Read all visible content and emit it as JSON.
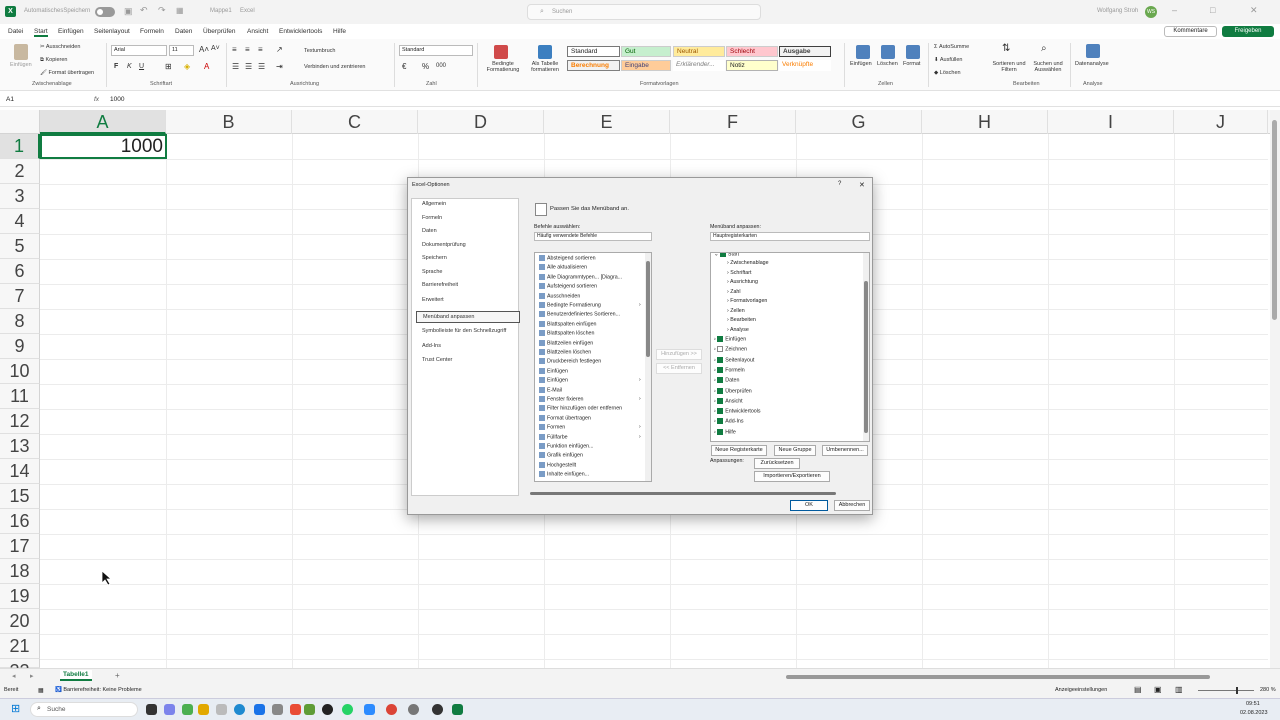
{
  "window": {
    "autosave_label": "AutomatischesSpeichern",
    "file_name": "Mappe1",
    "app_name": "Excel",
    "search_placeholder": "Suchen",
    "user_name": "Wolfgang Stroh",
    "user_initials": "WS"
  },
  "menu": {
    "items": [
      "Datei",
      "Start",
      "Einfügen",
      "Seitenlayout",
      "Formeln",
      "Daten",
      "Überprüfen",
      "Ansicht",
      "Entwicklertools",
      "Hilfe"
    ],
    "active": "Start",
    "comments_label": "Kommentare",
    "share_label": "Freigeben"
  },
  "ribbon": {
    "clipboard": {
      "paste": "Einfügen",
      "cut": "Ausschneiden",
      "copy": "Kopieren",
      "format_painter": "Format übertragen",
      "label": "Zwischenablage"
    },
    "font": {
      "name": "Arial",
      "size": "11",
      "bold": "F",
      "italic": "K",
      "underline": "U",
      "label": "Schriftart"
    },
    "alignment": {
      "wrap": "Textumbruch",
      "merge": "Verbinden und zentrieren",
      "label": "Ausrichtung"
    },
    "number": {
      "format": "Standard",
      "percent": "%",
      "comma": "000",
      "label": "Zahl"
    },
    "styles": {
      "cond_format": "Bedingte Formatierung",
      "as_table": "Als Tabelle formatieren",
      "cells": [
        "Standard",
        "Gut",
        "Neutral",
        "Schlecht",
        "Ausgabe",
        "Berechnung",
        "Eingabe",
        "Erklärender...",
        "Notiz",
        "Verknüpfte"
      ],
      "label": "Formatvorlagen"
    },
    "cells": {
      "insert": "Einfügen",
      "delete": "Löschen",
      "format": "Format",
      "label": "Zellen"
    },
    "editing": {
      "autosum": "AutoSumme",
      "fill": "Ausfüllen",
      "clear": "Löschen",
      "sort": "Sortieren und Filtern",
      "find": "Suchen und Auswählen",
      "label": "Bearbeiten"
    },
    "analysis": {
      "data_analysis": "Datenanalyse",
      "label": "Analyse"
    }
  },
  "formula_bar": {
    "name_box": "A1",
    "fx": "fx",
    "value": "1000"
  },
  "grid": {
    "columns": [
      "A",
      "B",
      "C",
      "D",
      "E",
      "F",
      "G",
      "H",
      "I",
      "J"
    ],
    "rows": [
      "1",
      "2",
      "3",
      "4",
      "5",
      "6",
      "7",
      "8",
      "9",
      "10",
      "11",
      "12",
      "13",
      "14",
      "15",
      "16",
      "17",
      "18",
      "19",
      "20",
      "21",
      "22"
    ],
    "a1_value": "1000"
  },
  "dialog": {
    "title": "Excel-Optionen",
    "help": "?",
    "close": "✕",
    "categories": [
      "Allgemein",
      "Formeln",
      "Daten",
      "Dokumentprüfung",
      "Speichern",
      "Sprache",
      "Barrierefreiheit",
      "Erweitert",
      "Menüband anpassen",
      "Symbolleiste für den Schnellzugriff",
      "Add-Ins",
      "Trust Center"
    ],
    "active_category": "Menüband anpassen",
    "heading": "Passen Sie das Menüband an.",
    "commands_label": "Befehle auswählen:",
    "commands_select": "Häufig verwendete Befehle",
    "ribbon_label": "Menüband anpassen:",
    "ribbon_select": "Hauptregisterkarten",
    "commands": [
      "Absteigend sortieren",
      "Alle aktualisieren",
      "Alle Diagrammtypen... [Diagra...",
      "Aufsteigend sortieren",
      "Ausschneiden",
      "Bedingte Formatierung",
      "Benutzerdefiniertes Sortieren...",
      "Blattspalten einfügen",
      "Blattspalten löschen",
      "Blattzeilen einfügen",
      "Blattzeilen löschen",
      "Druckbereich festlegen",
      "Einfügen",
      "Einfügen",
      "E-Mail",
      "Fenster fixieren",
      "Filter hinzufügen oder entfernen",
      "Format übertragen",
      "Formen",
      "Füllfarbe",
      "Funktion einfügen...",
      "Grafik einfügen",
      "Hochgestellt",
      "Inhalte einfügen..."
    ],
    "add_button": "Hinzufügen >>",
    "remove_button": "<< Entfernen",
    "tree_root": "Start",
    "tree_children": [
      "Zwischenablage",
      "Schriftart",
      "Ausrichtung",
      "Zahl",
      "Formatvorlagen",
      "Zellen",
      "Bearbeiten",
      "Analyse"
    ],
    "tabs": [
      {
        "label": "Einfügen",
        "checked": true
      },
      {
        "label": "Zeichnen",
        "checked": false
      },
      {
        "label": "Seitenlayout",
        "checked": true
      },
      {
        "label": "Formeln",
        "checked": true
      },
      {
        "label": "Daten",
        "checked": true
      },
      {
        "label": "Überprüfen",
        "checked": true
      },
      {
        "label": "Ansicht",
        "checked": true
      },
      {
        "label": "Entwicklertools",
        "checked": true
      },
      {
        "label": "Add-Ins",
        "checked": true
      },
      {
        "label": "Hilfe",
        "checked": true
      }
    ],
    "new_tab": "Neue Registerkarte",
    "new_group": "Neue Gruppe",
    "rename": "Umbenennen...",
    "customizations_label": "Anpassungen:",
    "reset": "Zurücksetzen",
    "import_export": "Importieren/Exportieren",
    "ok": "OK",
    "cancel": "Abbrechen"
  },
  "sheet": {
    "tab": "Tabelle1",
    "add": "+"
  },
  "status": {
    "ready": "Bereit",
    "accessibility": "Barrierefreiheit: Keine Probleme",
    "display_settings": "Anzeigeeinstellungen",
    "zoom": "280 %"
  },
  "taskbar": {
    "search": "Suche",
    "time": "09:51",
    "date": "02.08.2023"
  },
  "colors": {
    "accent": "#107c41",
    "dialog_bg": "#f0f0f0"
  }
}
